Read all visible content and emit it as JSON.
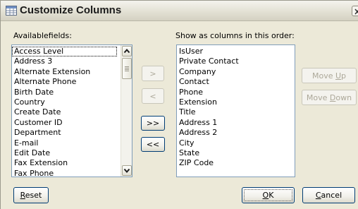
{
  "window": {
    "title": "Customize Columns",
    "icon": "window-grid-icon",
    "close_icon": "close-icon"
  },
  "available": {
    "label": "Availablefields:",
    "items": [
      "Access Level",
      "Address 3",
      "Alternate Extension",
      "Alternate Phone",
      "Birth Date",
      "Country",
      "Create Date",
      "Customer ID",
      "Department",
      "E-mail",
      "Edit Date",
      "Fax Extension",
      "Fax Phone"
    ],
    "focused_index": 0
  },
  "selected": {
    "label": "Show as columns in this order:",
    "items": [
      "IsUser",
      "Private Contact",
      "Company",
      "Contact",
      "Phone",
      "Extension",
      "Title",
      "Address 1",
      "Address 2",
      "City",
      "State",
      "ZIP Code"
    ]
  },
  "buttons": {
    "add": ">",
    "remove": "<",
    "add_all": ">>",
    "remove_all": "<<",
    "move_up_pre": "Move ",
    "move_up_key": "U",
    "move_up_post": "p",
    "move_down_pre": "Move ",
    "move_down_key": "D",
    "move_down_post": "own",
    "reset_key": "R",
    "reset_post": "eset",
    "ok_key": "O",
    "ok_post": "K",
    "cancel_key": "C",
    "cancel_post": "ancel"
  },
  "colors": {
    "dialog_bg": "#ece9d8",
    "list_border": "#7f9db9",
    "button_border": "#003c74",
    "disabled_text": "#aca899"
  }
}
